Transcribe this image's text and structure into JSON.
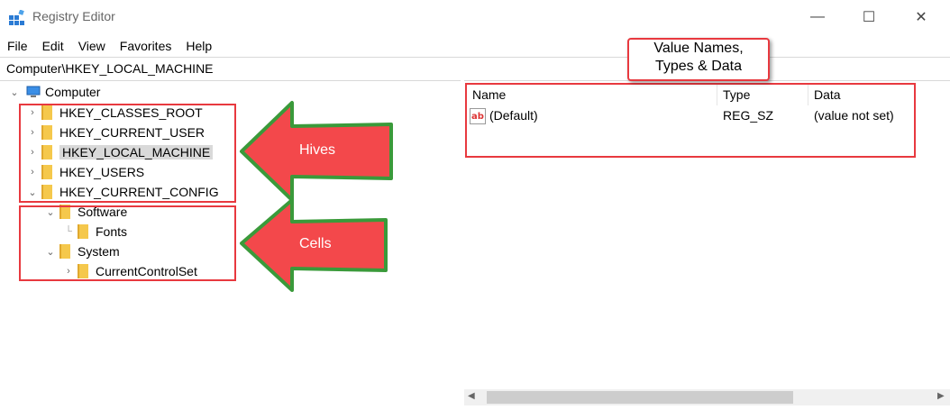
{
  "window": {
    "title": "Registry Editor",
    "minimize_glyph": "—",
    "maximize_glyph": "☐",
    "close_glyph": "✕"
  },
  "menu": [
    "File",
    "Edit",
    "View",
    "Favorites",
    "Help"
  ],
  "address": "Computer\\HKEY_LOCAL_MACHINE",
  "tree": {
    "root": "Computer",
    "hives": [
      "HKEY_CLASSES_ROOT",
      "HKEY_CURRENT_USER",
      "HKEY_LOCAL_MACHINE",
      "HKEY_USERS",
      "HKEY_CURRENT_CONFIG"
    ],
    "selected": "HKEY_LOCAL_MACHINE",
    "children": {
      "software": "Software",
      "fonts": "Fonts",
      "system": "System",
      "current_control_set": "CurrentControlSet"
    }
  },
  "list": {
    "columns": [
      "Name",
      "Type",
      "Data"
    ],
    "rows": [
      {
        "name": "(Default)",
        "type": "REG_SZ",
        "data": "(value not set)",
        "icon": "string-value-icon"
      }
    ]
  },
  "annotations": {
    "hives_label": "Hives",
    "cells_label": "Cells",
    "callout_line1": "Value Names,",
    "callout_line2": "Types & Data",
    "accent_red": "#e8393f",
    "arrow_red": "#f3484b",
    "arrow_outline": "#3a9a3a"
  }
}
